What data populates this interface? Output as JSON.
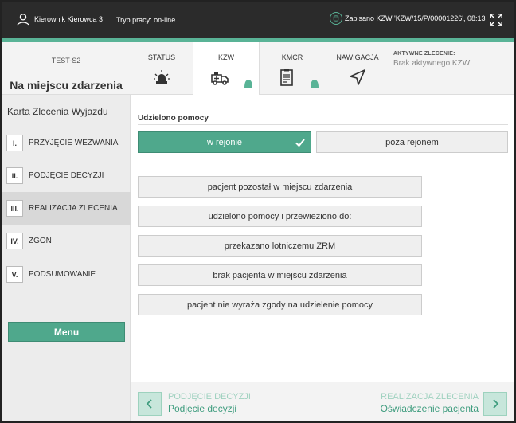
{
  "topbar": {
    "user": "Kierownik Kierowca 3",
    "mode": "Tryb pracy: on-line",
    "saved": "Zapisano KZW 'KZW/15/P/00001226', 08:13",
    "icons": {
      "user": "user-icon",
      "saved": "database-icon",
      "fullscreen": "fullscreen-icon"
    }
  },
  "header": {
    "code": "TEST-S2",
    "state": "Na miejscu zdarzenia",
    "tabs": [
      {
        "label": "STATUS",
        "icon": "siren-icon"
      },
      {
        "label": "KZW",
        "icon": "ambulance-icon"
      },
      {
        "label": "KMCR",
        "icon": "clipboard-icon"
      },
      {
        "label": "NAWIGACJA",
        "icon": "navigation-arrow-icon"
      }
    ],
    "active_order_label": "AKTYWNE ZLECENIE:",
    "active_order_value": "Brak aktywnego KZW"
  },
  "sidebar": {
    "title": "Karta Zlecenia Wyjazdu",
    "items": [
      {
        "num": "I.",
        "label": "PRZYJĘCIE WEZWANIA"
      },
      {
        "num": "II.",
        "label": "PODJĘCIE DECYZJI"
      },
      {
        "num": "III.",
        "label": "REALIZACJA ZLECENIA"
      },
      {
        "num": "IV.",
        "label": "ZGON"
      },
      {
        "num": "V.",
        "label": "PODSUMOWANIE"
      }
    ],
    "menu_label": "Menu"
  },
  "main": {
    "section_title": "Udzielono pomocy",
    "segment": {
      "on": "w rejonie",
      "off": "poza rejonem"
    },
    "options": [
      "pacjent pozostał w miejscu zdarzenia",
      "udzielono pomocy i przewieziono do:",
      "przekazano lotniczemu ZRM",
      "brak pacjenta w miejscu zdarzenia",
      "pacjent nie wyraża zgody na udzielenie pomocy"
    ]
  },
  "footer": {
    "prev_section": "PODJĘCIE DECYZJI",
    "prev_page": "Podjęcie decyzji",
    "next_section": "REALIZACJA ZLECENIA",
    "next_page": "Oświadczenie pacjenta"
  },
  "colors": {
    "accent": "#4fa88c",
    "topbar": "#2b2b2b",
    "light_accent": "#c7e6db"
  }
}
